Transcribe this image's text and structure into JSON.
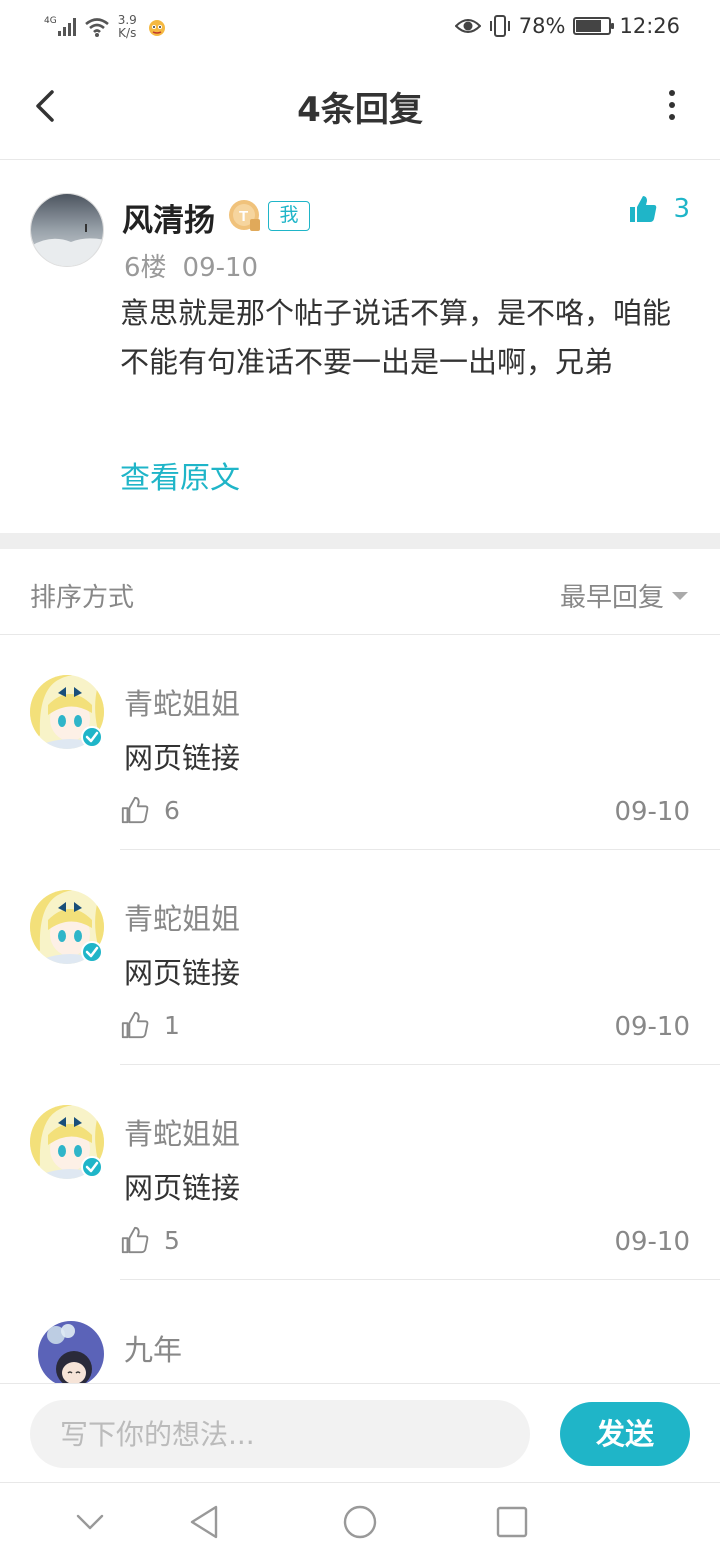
{
  "status_bar": {
    "network": "4G",
    "speed_value": "3.9",
    "speed_unit": "K/s",
    "battery_percent": "78%",
    "battery_level": 0.78,
    "time": "12:26"
  },
  "header": {
    "title": "4条回复"
  },
  "post": {
    "author": "风清扬",
    "me_tag": "我",
    "like_count": "3",
    "floor": "6楼",
    "date": "09-10",
    "content": "意思就是那个帖子说话不算，是不咯，咱能不能有句准话不要一出是一出啊，兄弟",
    "view_original": "查看原文"
  },
  "sort": {
    "label": "排序方式",
    "value": "最早回复"
  },
  "replies": [
    {
      "author": "青蛇姐姐",
      "text": "网页链接",
      "likes": "6",
      "date": "09-10"
    },
    {
      "author": "青蛇姐姐",
      "text": "网页链接",
      "likes": "1",
      "date": "09-10"
    },
    {
      "author": "青蛇姐姐",
      "text": "网页链接",
      "likes": "5",
      "date": "09-10"
    },
    {
      "author": "九年"
    }
  ],
  "composer": {
    "placeholder": "写下你的想法...",
    "send_label": "发送"
  },
  "colors": {
    "accent": "#1fb5c8",
    "text_primary": "#333333",
    "text_secondary": "#888888",
    "divider": "#e8e8e8"
  },
  "icons": {
    "back": "chevron-left-icon",
    "more": "more-vertical-icon",
    "like": "thumbs-up-icon",
    "verified": "verified-check-icon",
    "nav_back": "triangle-back-icon",
    "nav_home": "circle-home-icon",
    "nav_recent": "square-recent-icon",
    "nav_collapse": "chevron-down-icon"
  }
}
